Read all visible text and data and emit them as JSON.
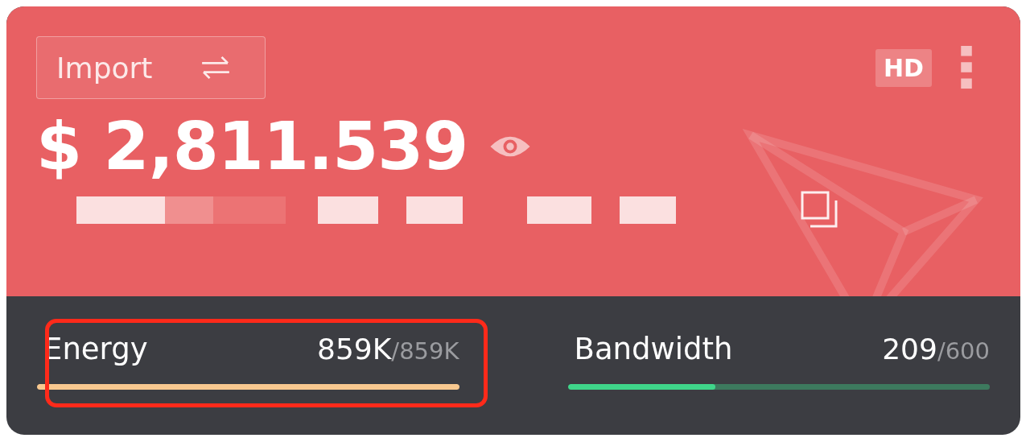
{
  "wallet": {
    "import_button": "Import",
    "hd_badge": "HD",
    "balance": "$ 2,811.539"
  },
  "resources": [
    {
      "name": "Energy",
      "used": "859K",
      "total": "/859K",
      "level": 1,
      "color": "#f8c88f",
      "highlighted": true
    },
    {
      "name": "Bandwidth",
      "used": "209",
      "total": "/600",
      "level": 0.35,
      "color": "#3fd68a",
      "highlighted": false
    }
  ]
}
